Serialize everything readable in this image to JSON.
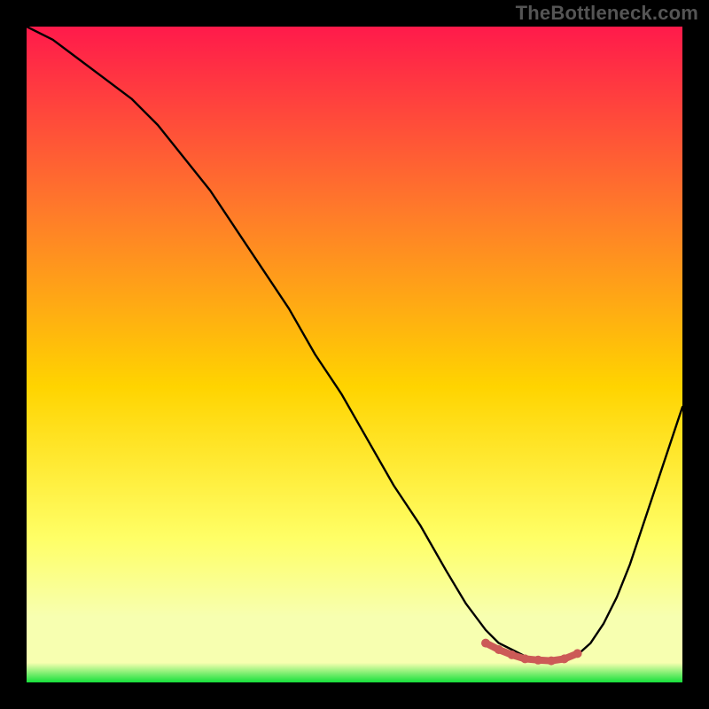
{
  "watermark": "TheBottleneck.com",
  "colors": {
    "bg": "#000000",
    "grad_top": "#ff1a4b",
    "grad_mid1": "#ff7a2a",
    "grad_mid2": "#ffd400",
    "grad_low": "#ffff66",
    "grad_pale": "#f7ffb0",
    "grad_bottom": "#16e03b",
    "curve": "#000000",
    "marker": "#cc5a57"
  },
  "chart_data": {
    "type": "line",
    "title": "",
    "xlabel": "",
    "ylabel": "",
    "xlim": [
      0,
      100
    ],
    "ylim": [
      0,
      100
    ],
    "series": [
      {
        "name": "bottleneck-curve",
        "x": [
          0,
          4,
          8,
          12,
          16,
          20,
          24,
          28,
          32,
          36,
          40,
          44,
          48,
          52,
          56,
          60,
          64,
          67,
          70,
          72,
          74,
          76,
          78,
          80,
          82,
          84,
          86,
          88,
          90,
          92,
          94,
          96,
          98,
          100
        ],
        "values": [
          100,
          98,
          95,
          92,
          89,
          85,
          80,
          75,
          69,
          63,
          57,
          50,
          44,
          37,
          30,
          24,
          17,
          12,
          8,
          6,
          5,
          4,
          3.5,
          3.2,
          3.5,
          4.2,
          6,
          9,
          13,
          18,
          24,
          30,
          36,
          42
        ]
      }
    ],
    "markers": {
      "name": "optimal-range",
      "x": [
        70,
        72,
        74,
        76,
        78,
        80,
        82,
        84
      ],
      "values": [
        6.0,
        5.0,
        4.2,
        3.6,
        3.4,
        3.3,
        3.6,
        4.4
      ]
    }
  }
}
